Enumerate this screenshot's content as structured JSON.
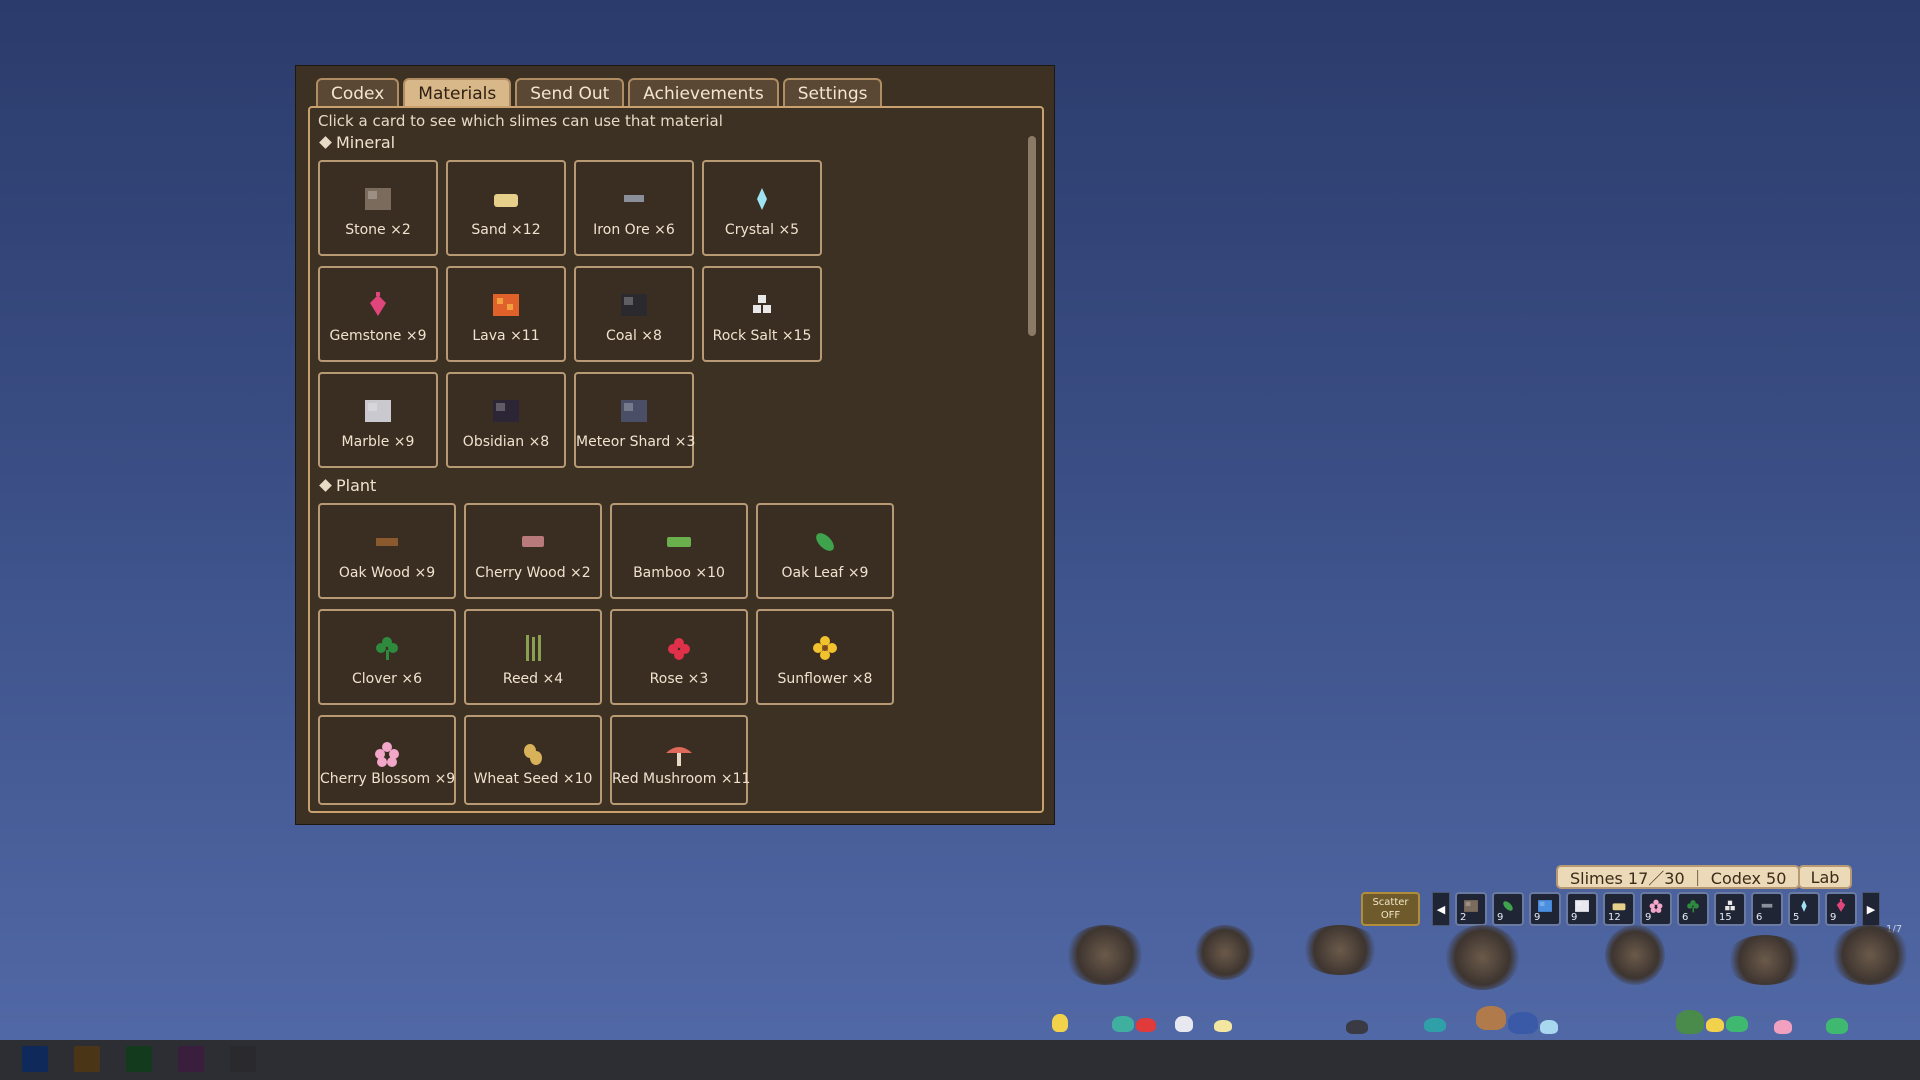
{
  "tabs": [
    "Codex",
    "Materials",
    "Send Out",
    "Achievements",
    "Settings"
  ],
  "active_tab": "Materials",
  "hint": "Click a card to see which slimes can use that material",
  "sections": {
    "mineral": {
      "title": "Mineral",
      "items": [
        {
          "label": "Stone  ×2",
          "icon": "stone-icon",
          "color": "#7b6b5c"
        },
        {
          "label": "Sand  ×12",
          "icon": "sand-icon",
          "color": "#e6cf8a"
        },
        {
          "label": "Iron Ore  ×6",
          "icon": "iron-ore-icon",
          "color": "#8a8f99"
        },
        {
          "label": "Crystal  ×5",
          "icon": "crystal-icon",
          "color": "#9fe3f2"
        },
        {
          "label": "Gemstone  ×9",
          "icon": "gemstone-icon",
          "color": "#e0457b"
        },
        {
          "label": "Lava  ×11",
          "icon": "lava-icon",
          "color": "#e0622a"
        },
        {
          "label": "Coal  ×8",
          "icon": "coal-icon",
          "color": "#2a2a2e"
        },
        {
          "label": "Rock Salt  ×15",
          "icon": "rock-salt-icon",
          "color": "#e8e8e8"
        },
        {
          "label": "Marble  ×9",
          "icon": "marble-icon",
          "color": "#c9c9cf"
        },
        {
          "label": "Obsidian  ×8",
          "icon": "obsidian-icon",
          "color": "#2b2535"
        },
        {
          "label": "Meteor Shard  ×3",
          "icon": "meteor-shard-icon",
          "color": "#4a4e66"
        }
      ]
    },
    "plant": {
      "title": "Plant",
      "items": [
        {
          "label": "Oak Wood  ×9",
          "icon": "oak-wood-icon",
          "color": "#8a5a2e"
        },
        {
          "label": "Cherry Wood  ×2",
          "icon": "cherry-wood-icon",
          "color": "#b87a7a"
        },
        {
          "label": "Bamboo  ×10",
          "icon": "bamboo-icon",
          "color": "#6ab04c"
        },
        {
          "label": "Oak Leaf  ×9",
          "icon": "oak-leaf-icon",
          "color": "#3fa34d"
        },
        {
          "label": "Clover  ×6",
          "icon": "clover-icon",
          "color": "#2e8b3e"
        },
        {
          "label": "Reed  ×4",
          "icon": "reed-icon",
          "color": "#8aa050"
        },
        {
          "label": "Rose  ×3",
          "icon": "rose-icon",
          "color": "#e0304a"
        },
        {
          "label": "Sunflower  ×8",
          "icon": "sunflower-icon",
          "color": "#f2c12e"
        },
        {
          "label": "Cherry Blossom  ×9",
          "icon": "cherry-blossom-icon",
          "color": "#f2a6c8"
        },
        {
          "label": "Wheat Seed  ×10",
          "icon": "wheat-seed-icon",
          "color": "#d8b25a"
        },
        {
          "label": "Red Mushroom  ×11",
          "icon": "red-mushroom-icon",
          "color": "#e06a5a"
        }
      ]
    }
  },
  "hud": {
    "stats": "Slimes 17／30 ｜ Codex 50",
    "lab": "Lab",
    "scatter_line1": "Scatter",
    "scatter_line2": "OFF",
    "hotbar": [
      {
        "count": "2",
        "icon": "stone-icon",
        "color": "#7b6b5c"
      },
      {
        "count": "9",
        "icon": "oak-leaf-icon",
        "color": "#3fa34d"
      },
      {
        "count": "9",
        "icon": "potion-icon",
        "color": "#4a8fe0"
      },
      {
        "count": "9",
        "icon": "feather-icon",
        "color": "#e8e8f0"
      },
      {
        "count": "12",
        "icon": "sand-icon",
        "color": "#e6cf8a"
      },
      {
        "count": "9",
        "icon": "cherry-blossom-icon",
        "color": "#f2a6c8"
      },
      {
        "count": "6",
        "icon": "clover-icon",
        "color": "#2e8b3e"
      },
      {
        "count": "15",
        "icon": "rock-salt-icon",
        "color": "#e8e8e8"
      },
      {
        "count": "6",
        "icon": "iron-ore-icon",
        "color": "#8a8f99"
      },
      {
        "count": "5",
        "icon": "crystal-icon",
        "color": "#9fe3f2"
      },
      {
        "count": "9",
        "icon": "gemstone-icon",
        "color": "#e0457b"
      }
    ],
    "pager": "1/7"
  },
  "taskbar_colors": [
    "#0f2a5a",
    "#4a3516",
    "#143a1e",
    "#3a1e3e",
    "#2a2a2e"
  ]
}
